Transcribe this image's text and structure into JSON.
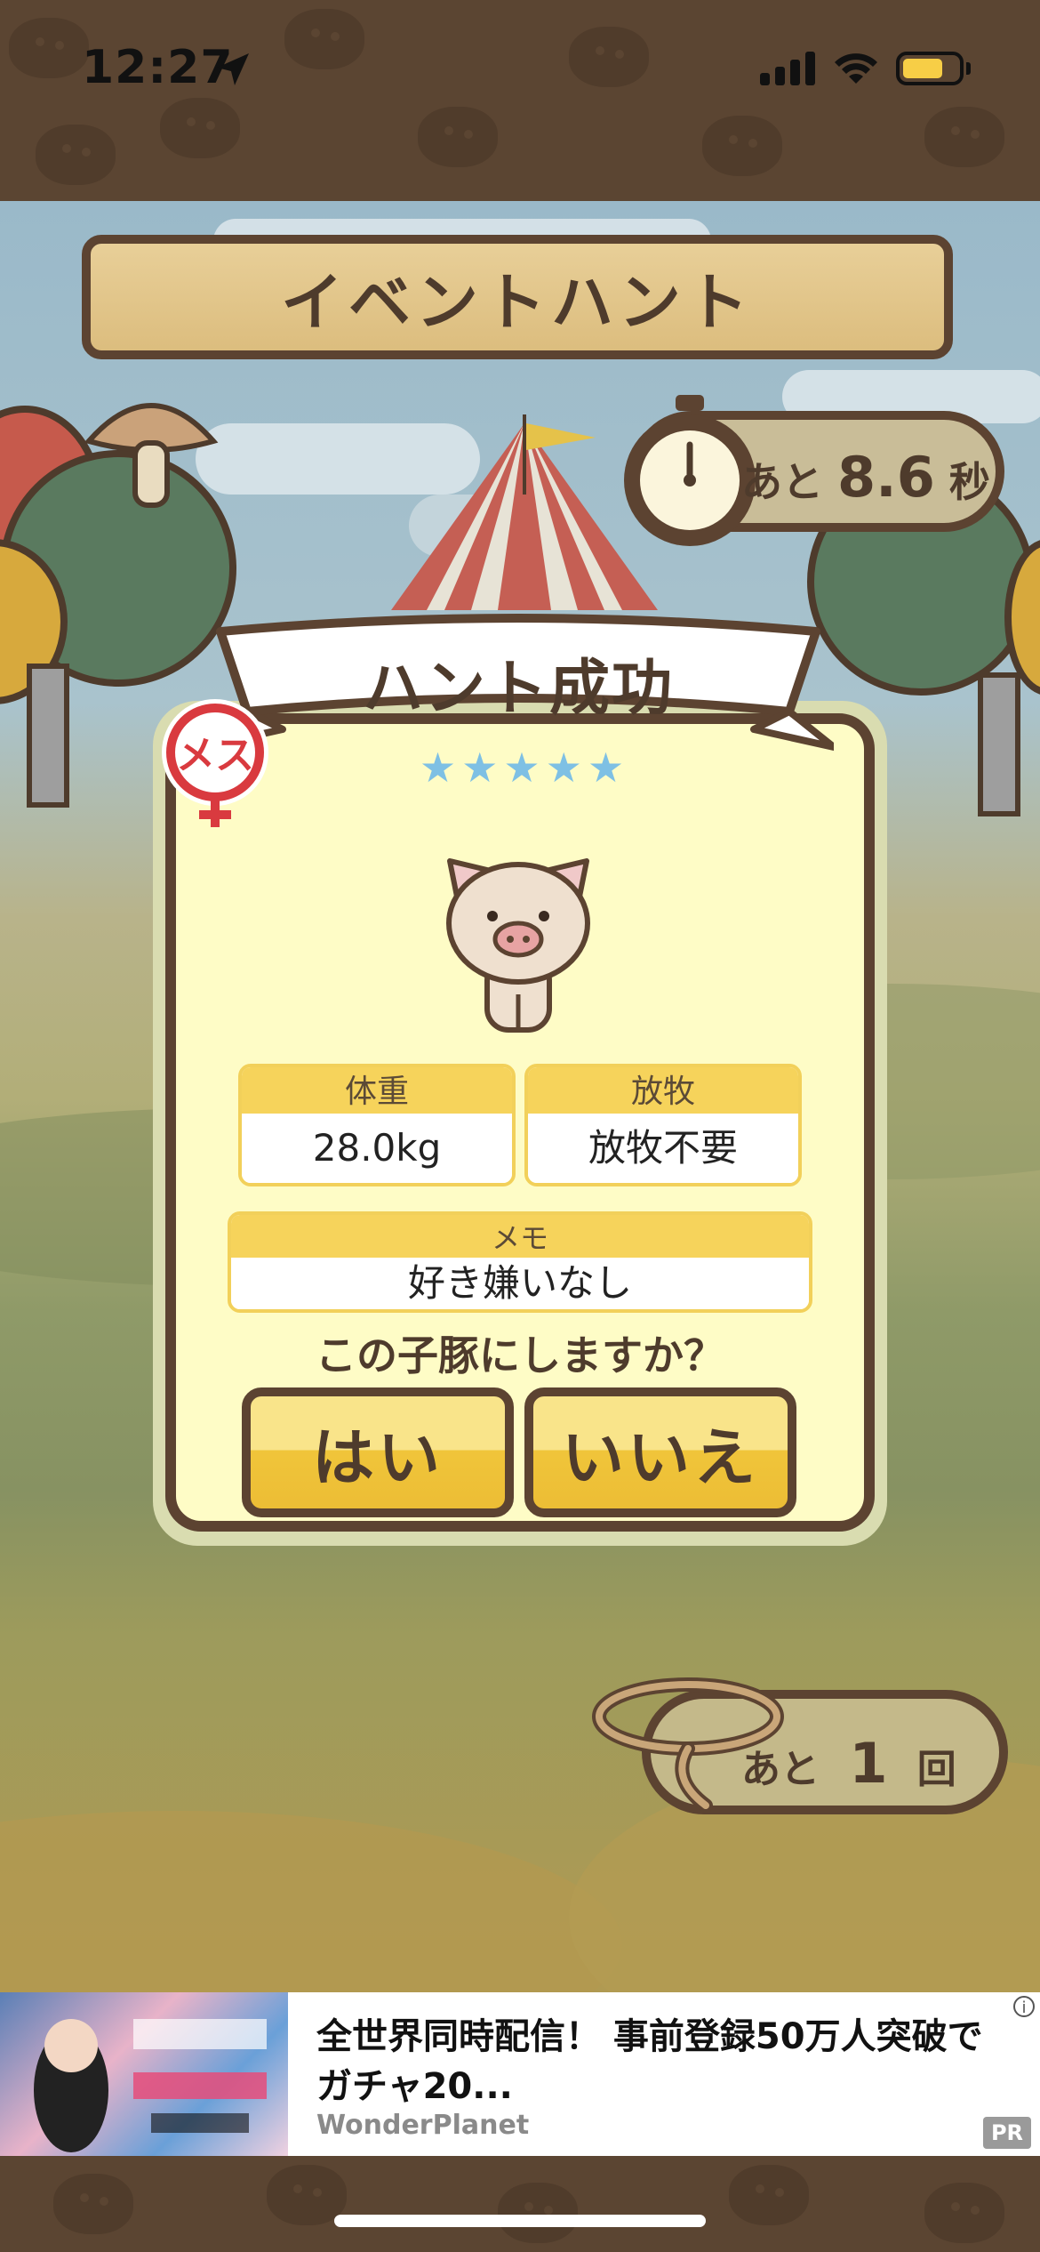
{
  "status_bar": {
    "time": "12:27"
  },
  "game": {
    "title": "イベントハント",
    "timer": {
      "prefix": "あと",
      "value": "8.6",
      "unit": "秒"
    },
    "result": {
      "title": "ハント成功",
      "stars": "★★★★★",
      "gender_badge": "メス",
      "fields": {
        "weight": {
          "label": "体重",
          "value": "28.0kg"
        },
        "grazing": {
          "label": "放牧",
          "value": "放牧不要"
        },
        "memo": {
          "label": "メモ",
          "value": "好き嫌いなし"
        }
      },
      "question": "この子豚にしますか？",
      "yes_label": "はい",
      "no_label": "いいえ"
    },
    "remaining": {
      "prefix": "あと",
      "value": "1",
      "unit": "回"
    }
  },
  "ad": {
    "title": "全世界同時配信！ 事前登録50万人突破でガチャ20...",
    "advertiser": "WonderPlanet",
    "info_glyph": "i",
    "pr_label": "PR"
  },
  "colors": {
    "wood_dark": "#5c4331",
    "panel_bg": "#fefcc6",
    "field_header": "#f6d35b",
    "star": "#7ec0e4",
    "female_red": "#d93a3f"
  }
}
